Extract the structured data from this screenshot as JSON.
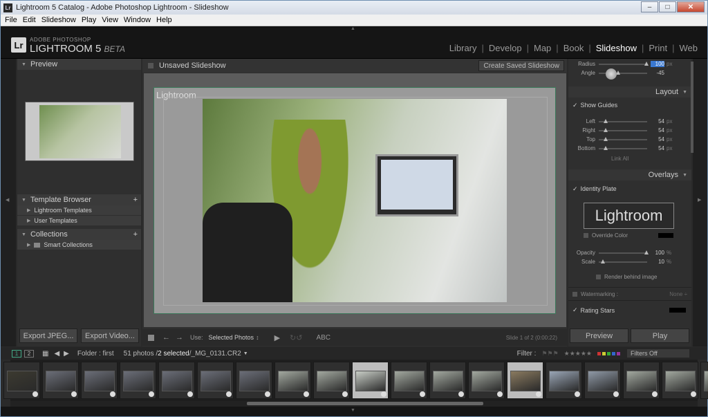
{
  "window": {
    "title": "Lightroom 5 Catalog - Adobe Photoshop Lightroom - Slideshow",
    "lr_badge": "Lr"
  },
  "menu": [
    "File",
    "Edit",
    "Slideshow",
    "Play",
    "View",
    "Window",
    "Help"
  ],
  "brand": {
    "small": "ADOBE PHOTOSHOP",
    "name": "LIGHTROOM 5",
    "beta": "BETA",
    "logo": "Lr"
  },
  "modules": [
    "Library",
    "Develop",
    "Map",
    "Book",
    "Slideshow",
    "Print",
    "Web"
  ],
  "active_module": "Slideshow",
  "left": {
    "preview": "Preview",
    "template_browser": "Template Browser",
    "templates": [
      "Lightroom Templates",
      "User Templates"
    ],
    "collections": "Collections",
    "collection_items": [
      "Smart Collections"
    ],
    "export_jpeg": "Export JPEG...",
    "export_video": "Export Video..."
  },
  "center": {
    "title": "Unsaved Slideshow",
    "save": "Create Saved Slideshow",
    "identity": "Lightroom",
    "use_label": "Use:",
    "use_value": "Selected Photos",
    "abc": "ABC",
    "slide_info": "Slide 1 of 2 (0:00:22)"
  },
  "right": {
    "shadow": [
      {
        "label": "Radius",
        "value": "100",
        "unit": "px",
        "fill": 1.0
      },
      {
        "label": "Angle",
        "value": "-45",
        "unit": "",
        "fill": 0.38
      }
    ],
    "layout_head": "Layout",
    "show_guides": "Show Guides",
    "guides": [
      {
        "label": "Left",
        "value": "54",
        "unit": "px",
        "fill": 0.1
      },
      {
        "label": "Right",
        "value": "54",
        "unit": "px",
        "fill": 0.1
      },
      {
        "label": "Top",
        "value": "54",
        "unit": "px",
        "fill": 0.1
      },
      {
        "label": "Bottom",
        "value": "54",
        "unit": "px",
        "fill": 0.1
      }
    ],
    "link_all": "Link All",
    "overlays_head": "Overlays",
    "identity_plate": "Identity Plate",
    "plate_text": "Lightroom",
    "override_color": "Override Color",
    "opacity": {
      "label": "Opacity",
      "value": "100",
      "unit": "%",
      "fill": 1.0
    },
    "scale": {
      "label": "Scale",
      "value": "10",
      "unit": "%",
      "fill": 0.05
    },
    "render_behind": "Render behind image",
    "watermarking": "Watermarking :",
    "watermark_value": "None ÷",
    "rating_stars": "Rating Stars",
    "preview_btn": "Preview",
    "play_btn": "Play"
  },
  "filmstrip": {
    "page1": "1",
    "page2": "2",
    "folder": "Folder : first",
    "count": "51 photos /",
    "selected": "2 selected",
    "file": "/_MG_0131.CR2",
    "filter_label": "Filter :",
    "filters_off": "Filters Off",
    "stars": "★★★★★"
  },
  "colors": {
    "accent_slide": "#3a7a5a",
    "title_blue": "#6f8fb0",
    "close_red": "#c6472f"
  }
}
